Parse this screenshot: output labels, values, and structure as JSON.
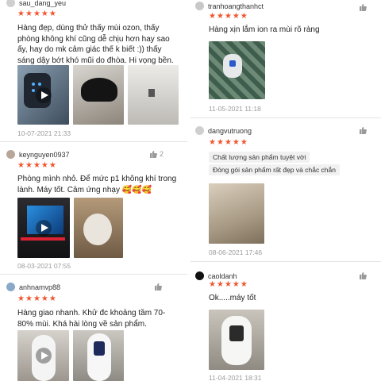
{
  "reviews": [
    {
      "username": "sau_dang_yeu",
      "rating": 5,
      "text": "Hàng đẹp, dùng thử thấy mùi ozon, thấy phòng không khí cũng dễ chịu hơn hay sao ấy, hay do mk cảm giác thế k biết :)) thấy sáng dậy bớt khó mũi do đhòa. Hi vọng bền. Tạm thời ưng",
      "date": "10-07-2021 21:33"
    },
    {
      "username": "keynguyen0937",
      "rating": 5,
      "likes": "2",
      "text": "Phòng mình nhỏ. Để mức p1 không khí trong lành. Máy tốt. Cảm ứng nhạy 🥰🥰🥰",
      "date": "08-03-2021 07:55"
    },
    {
      "username": "anhnamvp88",
      "rating": 5,
      "text": "Hàng giao nhanh. Khử đc khoảng tầm 70-80% mùi. Khá hài lòng về sản phẩm."
    },
    {
      "username": "tranhoangthanhct",
      "rating": 5,
      "text": "Hàng xịn lắm ion ra mùi rõ ràng",
      "date": "11-05-2021 11:18"
    },
    {
      "username": "dangvutruong",
      "rating": 5,
      "tags": [
        "Chất lượng sản phẩm tuyệt vời",
        "Đóng gói sản phẩm rất đẹp và chắc chắn"
      ],
      "date": "08-06-2021 17:46"
    },
    {
      "username": "caoldanh",
      "rating": 5,
      "text": "Ok.....máy tốt",
      "date": "11-04-2021 18:31"
    }
  ],
  "colors": {
    "star": "#f0552d",
    "date": "#9c9c9c",
    "tag_bg": "#f1f1f1"
  },
  "icons": {
    "like": "thumbs-up-icon",
    "star": "star-icon",
    "play": "play-icon"
  }
}
